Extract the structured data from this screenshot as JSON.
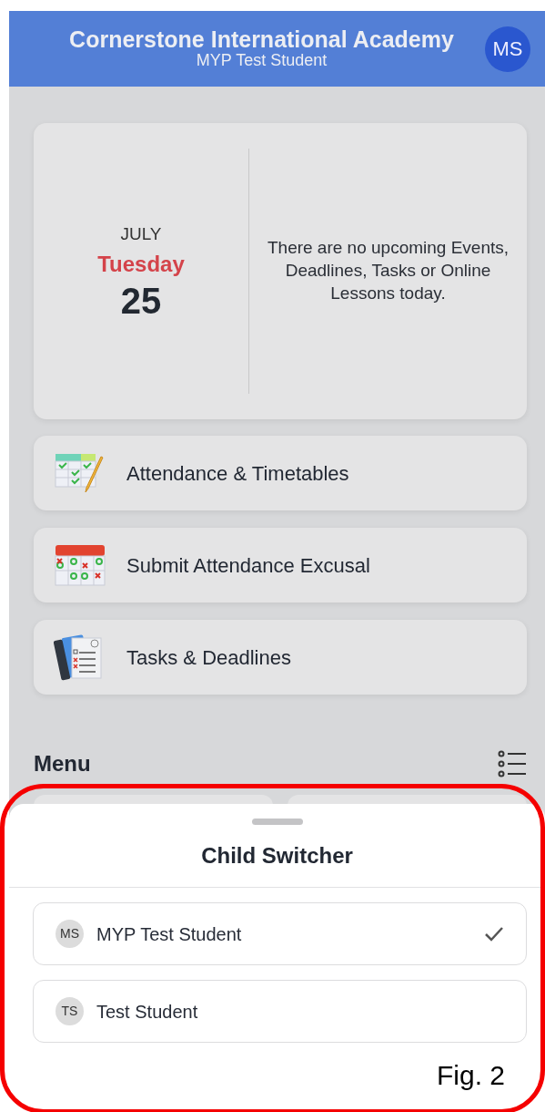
{
  "header": {
    "title": "Cornerstone International Academy",
    "subtitle": "MYP Test Student",
    "avatar": "MS"
  },
  "today": {
    "month": "JULY",
    "weekday": "Tuesday",
    "day": "25",
    "message": "There are no upcoming Events, Deadlines, Tasks or Online Lessons today."
  },
  "shortcuts": [
    {
      "label": "Attendance & Timetables",
      "kind": "timetable"
    },
    {
      "label": "Submit Attendance Excusal",
      "kind": "calendar"
    },
    {
      "label": "Tasks & Deadlines",
      "kind": "tasks"
    }
  ],
  "menu": {
    "title": "Menu"
  },
  "child_switcher": {
    "title": "Child Switcher",
    "children": [
      {
        "initials": "MS",
        "name": "MYP Test Student",
        "selected": true
      },
      {
        "initials": "TS",
        "name": "Test Student",
        "selected": false
      }
    ]
  },
  "figure_label": "Fig. 2"
}
